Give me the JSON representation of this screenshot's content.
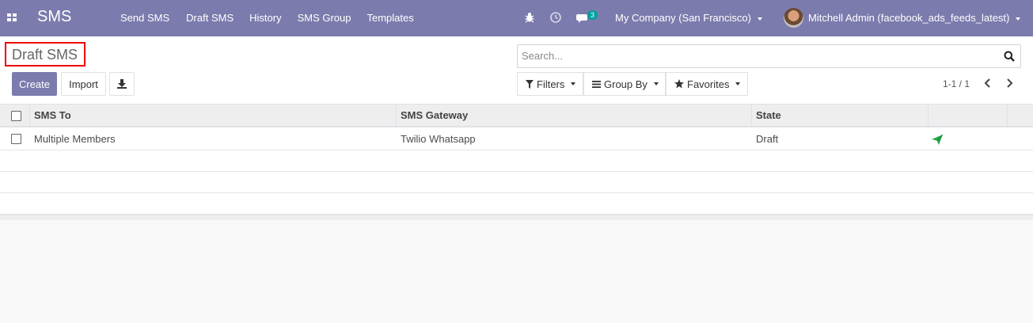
{
  "navbar": {
    "brand": "SMS",
    "menu": [
      "Send SMS",
      "Draft SMS",
      "History",
      "SMS Group",
      "Templates"
    ],
    "message_count": "3",
    "company": "My Company (San Francisco)",
    "user": "Mitchell Admin (facebook_ads_feeds_latest)"
  },
  "control_panel": {
    "title": "Draft SMS",
    "create_label": "Create",
    "import_label": "Import",
    "search_placeholder": "Search...",
    "filters_label": "Filters",
    "group_by_label": "Group By",
    "favorites_label": "Favorites",
    "pager": "1-1 / 1"
  },
  "table": {
    "columns": [
      "SMS To",
      "SMS Gateway",
      "State"
    ],
    "rows": [
      {
        "sms_to": "Multiple Members",
        "gateway": "Twilio Whatsapp",
        "state": "Draft"
      }
    ]
  },
  "colors": {
    "navbar": "#7c7bad",
    "primary_button": "#7c7bad",
    "badge": "#00a09d",
    "send_icon": "#28a745",
    "title_highlight": "#e00000"
  }
}
